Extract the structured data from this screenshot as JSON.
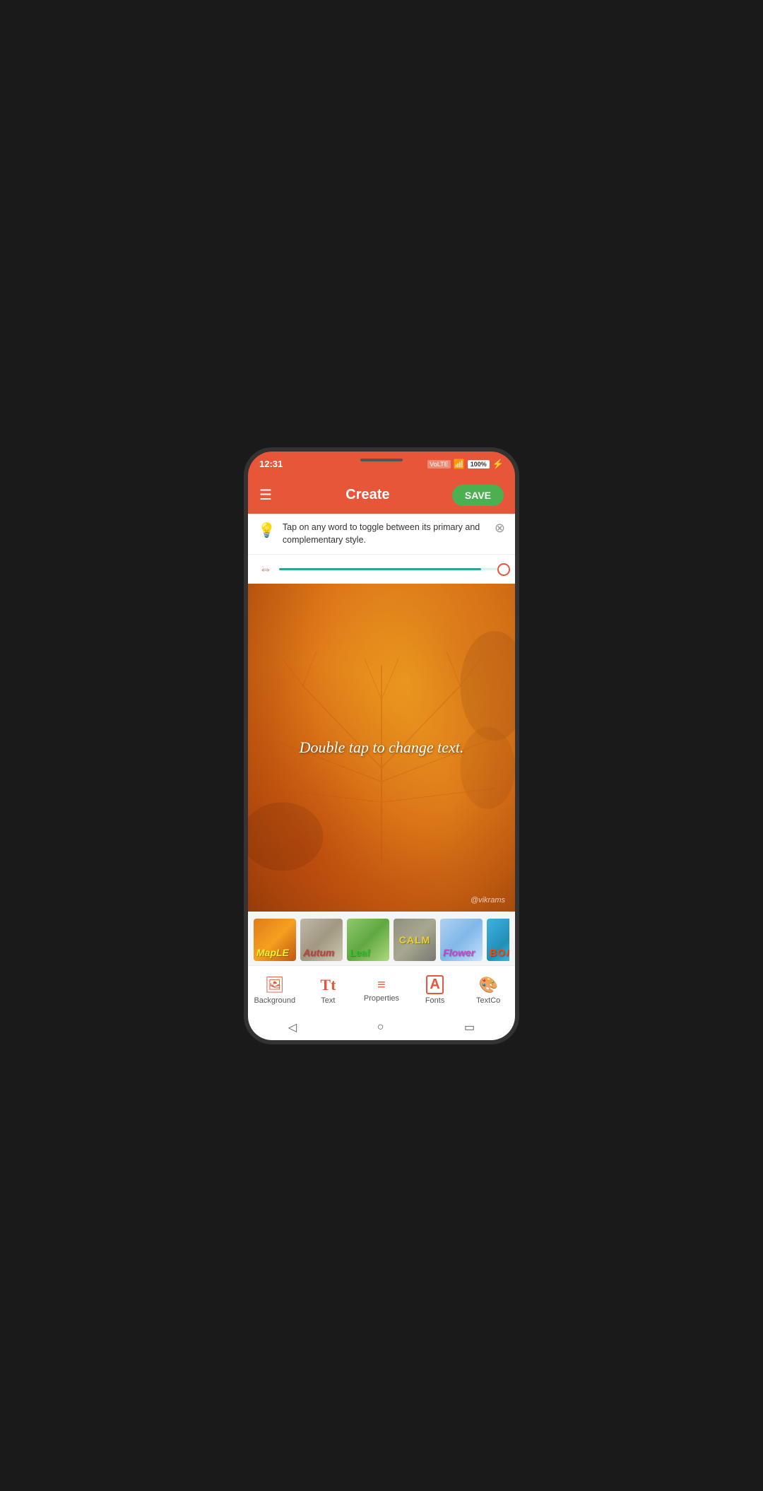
{
  "statusBar": {
    "time": "12:31",
    "batteryPercent": "100%",
    "signal": "4G"
  },
  "header": {
    "title": "Create",
    "menuIcon": "☰",
    "saveLabel": "SAVE"
  },
  "tip": {
    "icon": "💡",
    "text": "Tap on any word to toggle between its primary and complementary style.",
    "closeIcon": "⊗"
  },
  "slider": {
    "value": 90,
    "icon": "↔"
  },
  "canvas": {
    "instructionText": "Double tap to change text.",
    "watermark": "@vikrams"
  },
  "thumbnails": [
    {
      "id": "maple",
      "label": "MapLE"
    },
    {
      "id": "autumn",
      "label": "Autum"
    },
    {
      "id": "leaf",
      "label": "Leaf"
    },
    {
      "id": "calm",
      "label": "CALM"
    },
    {
      "id": "flower",
      "label": "Flower"
    },
    {
      "id": "boat",
      "label": "BOAT"
    }
  ],
  "bottomNav": [
    {
      "id": "background",
      "label": "Background",
      "icon": "🖼"
    },
    {
      "id": "text",
      "label": "Text",
      "icon": "Tt"
    },
    {
      "id": "properties",
      "label": "Properties",
      "icon": "≡"
    },
    {
      "id": "fonts",
      "label": "Fonts",
      "icon": "A"
    },
    {
      "id": "textcolor",
      "label": "TextCo",
      "icon": "🎨"
    }
  ],
  "colors": {
    "accent": "#e8563a",
    "headerBg": "#e8563a",
    "saveBtn": "#4caf50",
    "sliderColor": "#26a69a"
  }
}
